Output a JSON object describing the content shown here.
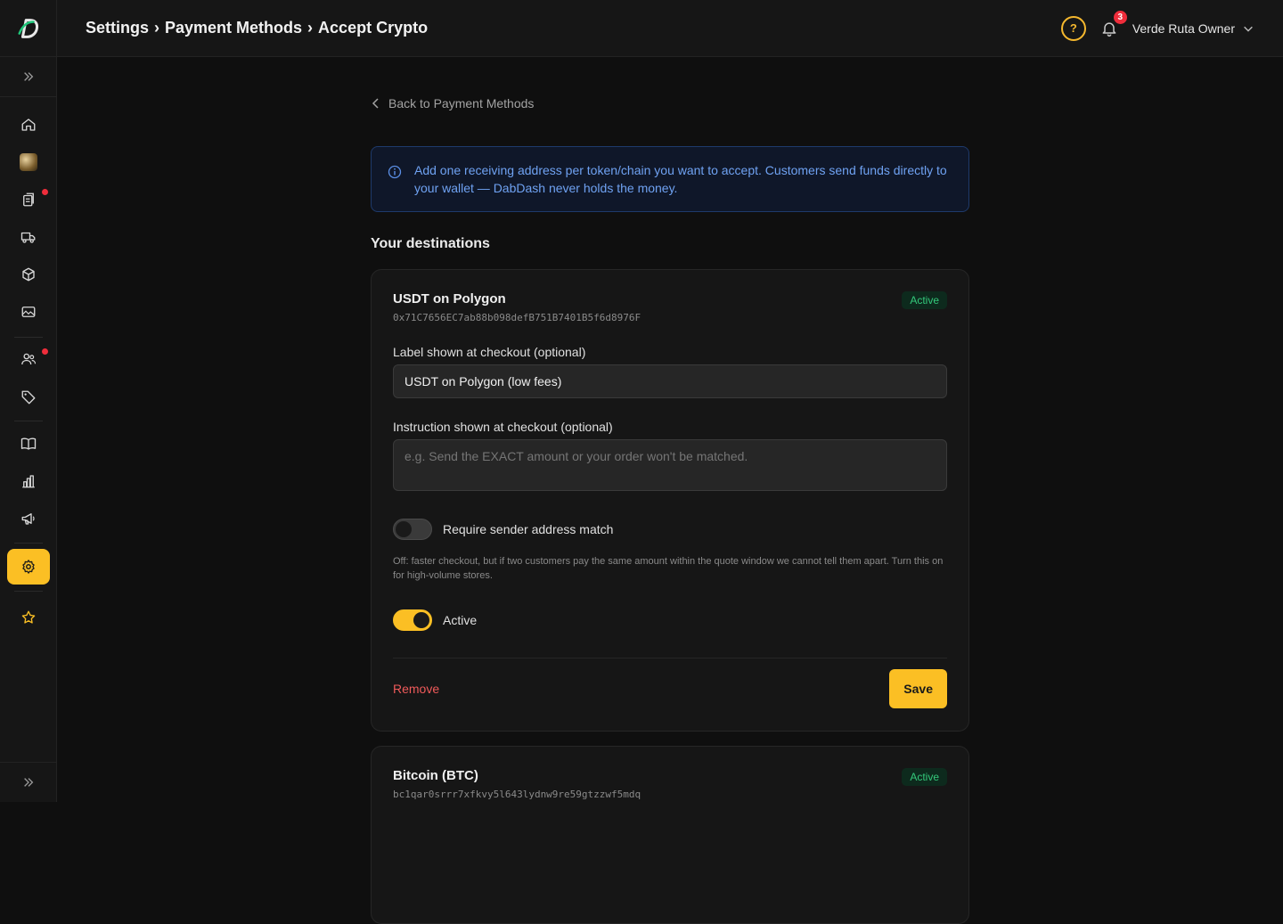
{
  "header": {
    "breadcrumb": [
      "Settings",
      "Payment Methods",
      "Accept Crypto"
    ],
    "separator": "›",
    "help_icon": "question-circle-icon",
    "notifications_count": "3",
    "user_name": "Verde Ruta Owner"
  },
  "sidebar": {
    "items": [
      {
        "icon": "home-icon"
      },
      {
        "icon": "store-avatar"
      },
      {
        "icon": "orders-icon",
        "dot": true
      },
      {
        "icon": "truck-icon"
      },
      {
        "icon": "box-icon"
      },
      {
        "icon": "image-icon"
      },
      {
        "icon": "users-icon",
        "dot": true
      },
      {
        "icon": "tag-icon"
      },
      {
        "icon": "book-icon"
      },
      {
        "icon": "chart-icon"
      },
      {
        "icon": "megaphone-icon"
      },
      {
        "icon": "gear-icon",
        "active": true
      },
      {
        "icon": "star-icon"
      }
    ],
    "accent": "#fbbf24"
  },
  "main": {
    "back_label": "Back to Payment Methods",
    "info_text": "Add one receiving address per token/chain you want to accept. Customers send funds directly to your wallet — DabDash never holds the money.",
    "section_title": "Your destinations",
    "destinations": [
      {
        "title": "USDT on Polygon",
        "address": "0x71C7656EC7ab88b098defB751B7401B5f6d8976F",
        "status": "Active",
        "label_field_label": "Label shown at checkout (optional)",
        "label_value": "USDT on Polygon (low fees)",
        "instruction_field_label": "Instruction shown at checkout (optional)",
        "instruction_placeholder": "e.g. Send the EXACT amount or your order won't be matched.",
        "sender_match_label": "Require sender address match",
        "sender_match_on": false,
        "sender_match_help": "Off: faster checkout, but if two customers pay the same amount within the quote window we cannot tell them apart. Turn this on for high-volume stores.",
        "active_label": "Active",
        "active_on": true,
        "remove_label": "Remove",
        "save_label": "Save"
      },
      {
        "title": "Bitcoin (BTC)",
        "address": "bc1qar0srrr7xfkvy5l643lydnw9re59gtzzwf5mdq",
        "status": "Active"
      }
    ]
  }
}
